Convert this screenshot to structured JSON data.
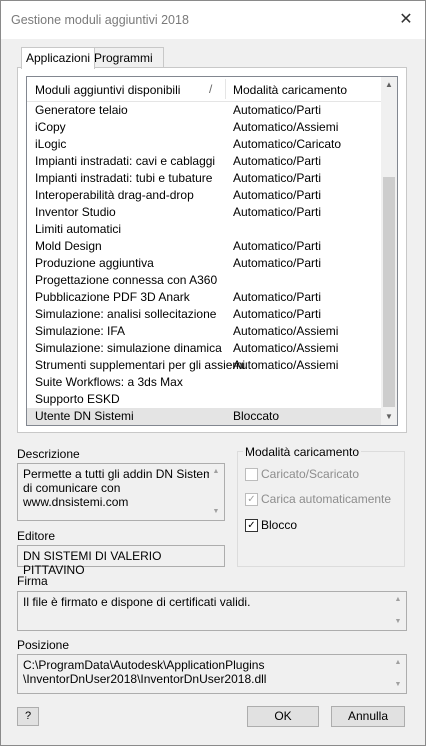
{
  "window": {
    "title": "Gestione moduli aggiuntivi 2018"
  },
  "tabs": [
    {
      "label": "Applicazioni",
      "active": true
    },
    {
      "label": "Programmi di conversione",
      "active": false
    }
  ],
  "list": {
    "headers": {
      "name": "Moduli aggiuntivi disponibili",
      "sort_glyph": "/",
      "mode": "Modalità caricamento"
    },
    "rows": [
      {
        "name": "Generatore telaio",
        "mode": "Automatico/Parti"
      },
      {
        "name": "iCopy",
        "mode": "Automatico/Assiemi"
      },
      {
        "name": "iLogic",
        "mode": "Automatico/Caricato"
      },
      {
        "name": "Impianti instradati: cavi e cablaggi",
        "mode": "Automatico/Parti"
      },
      {
        "name": "Impianti instradati: tubi e tubature",
        "mode": "Automatico/Parti"
      },
      {
        "name": "Interoperabilità drag-and-drop",
        "mode": "Automatico/Parti"
      },
      {
        "name": "Inventor Studio",
        "mode": "Automatico/Parti"
      },
      {
        "name": "Limiti automatici",
        "mode": ""
      },
      {
        "name": "Mold Design",
        "mode": "Automatico/Parti"
      },
      {
        "name": "Produzione aggiuntiva",
        "mode": "Automatico/Parti"
      },
      {
        "name": "Progettazione connessa con A360",
        "mode": ""
      },
      {
        "name": "Pubblicazione PDF 3D Anark",
        "mode": "Automatico/Parti"
      },
      {
        "name": "Simulazione: analisi sollecitazione",
        "mode": "Automatico/Parti"
      },
      {
        "name": "Simulazione: IFA",
        "mode": "Automatico/Assiemi"
      },
      {
        "name": "Simulazione: simulazione dinamica",
        "mode": "Automatico/Assiemi"
      },
      {
        "name": "Strumenti supplementari per gli assiemi",
        "mode": "Automatico/Assiemi"
      },
      {
        "name": "Suite Workflows: a 3ds Max",
        "mode": ""
      },
      {
        "name": "Supporto ESKD",
        "mode": ""
      },
      {
        "name": "Utente DN Sistemi",
        "mode": "Bloccato",
        "selected": true
      }
    ]
  },
  "descrizione": {
    "label": "Descrizione",
    "lines": [
      "Permette a tutti gli addin DN Sistemi",
      "di comunicare con",
      "www.dnsistemi.com"
    ]
  },
  "editore": {
    "label": "Editore",
    "value": "DN SISTEMI DI VALERIO PITTAVINO"
  },
  "modalita": {
    "label": "Modalità caricamento",
    "options": [
      {
        "label": "Caricato/Scaricato",
        "checked": false,
        "enabled": false
      },
      {
        "label": "Carica automaticamente",
        "checked": true,
        "enabled": false
      },
      {
        "label": "Blocco",
        "checked": true,
        "enabled": true
      }
    ]
  },
  "firma": {
    "label": "Firma",
    "value": "Il file è firmato e dispone di certificati validi."
  },
  "posizione": {
    "label": "Posizione",
    "lines": [
      "C:\\ProgramData\\Autodesk\\ApplicationPlugins",
      "\\InventorDnUser2018\\InventorDnUser2018.dll"
    ]
  },
  "buttons": {
    "ok": "OK",
    "cancel": "Annulla",
    "help": "?"
  },
  "icons": {
    "close": "close-icon",
    "help": "help-icon",
    "check": "checkmark-icon",
    "arrows": "scroll-arrow-icon"
  }
}
